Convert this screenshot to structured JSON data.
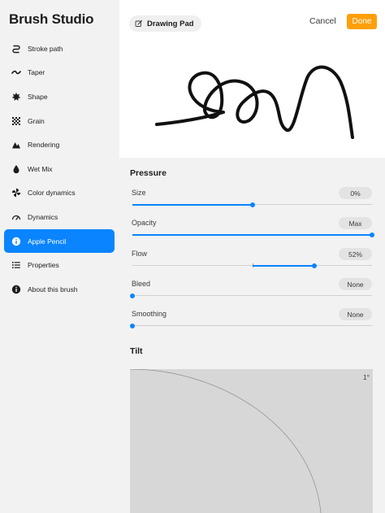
{
  "app": {
    "title": "Brush Studio"
  },
  "sidebar": {
    "items": [
      {
        "label": "Stroke path",
        "icon": "stroke-path-icon",
        "active": false
      },
      {
        "label": "Taper",
        "icon": "taper-icon",
        "active": false
      },
      {
        "label": "Shape",
        "icon": "shape-icon",
        "active": false
      },
      {
        "label": "Grain",
        "icon": "grain-icon",
        "active": false
      },
      {
        "label": "Rendering",
        "icon": "rendering-icon",
        "active": false
      },
      {
        "label": "Wet Mix",
        "icon": "wet-mix-icon",
        "active": false
      },
      {
        "label": "Color dynamics",
        "icon": "color-dynamics-icon",
        "active": false
      },
      {
        "label": "Dynamics",
        "icon": "dynamics-icon",
        "active": false
      },
      {
        "label": "Apple Pencil",
        "icon": "apple-pencil-icon",
        "active": true
      },
      {
        "label": "Properties",
        "icon": "properties-icon",
        "active": false
      },
      {
        "label": "About this brush",
        "icon": "about-icon",
        "active": false
      }
    ]
  },
  "header": {
    "drawing_pad_label": "Drawing Pad",
    "cancel_label": "Cancel",
    "done_label": "Done",
    "accent_color": "#ff9f0a"
  },
  "pressure": {
    "title": "Pressure",
    "rows": [
      {
        "label": "Size",
        "value": "0%",
        "level": 0.5,
        "centered": false
      },
      {
        "label": "Opacity",
        "value": "Max",
        "level": 1.0,
        "centered": false
      },
      {
        "label": "Flow",
        "value": "52%",
        "level": 0.76,
        "centered": true
      },
      {
        "label": "Bleed",
        "value": "None",
        "level": 0.0,
        "centered": false
      },
      {
        "label": "Smoothing",
        "value": "None",
        "level": 0.0,
        "centered": false
      }
    ]
  },
  "tilt": {
    "title": "Tilt",
    "value": "1°"
  },
  "colors": {
    "selection": "#0a84ff",
    "sidebar_bg": "#f2f2f2"
  }
}
